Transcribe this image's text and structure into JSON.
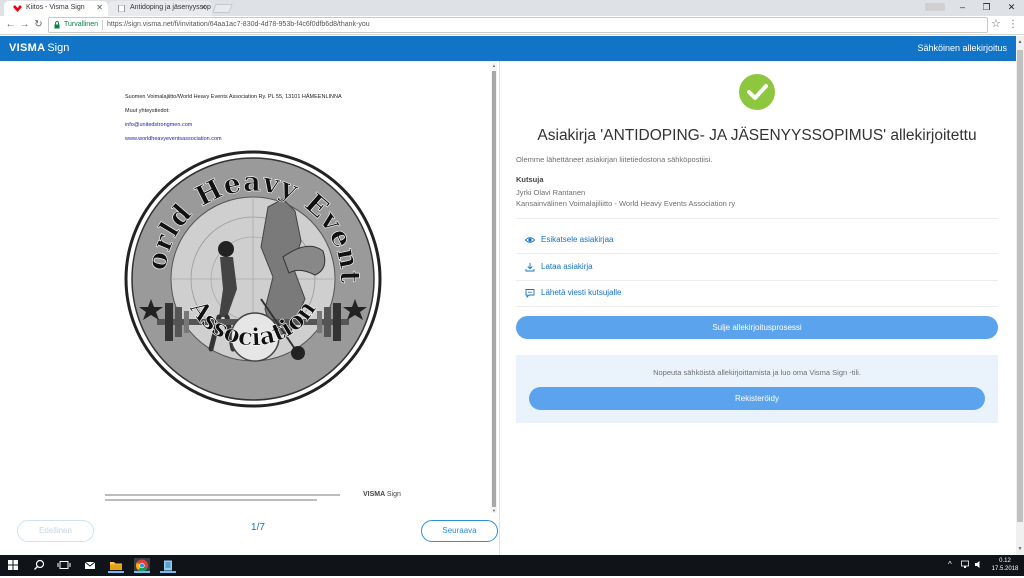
{
  "browser": {
    "tabs": [
      {
        "title": "Kiitos - Visma Sign",
        "active": true
      },
      {
        "title": "Antidoping ja jäsenyyssop",
        "active": false
      }
    ],
    "profile": "",
    "window_controls": {
      "minimize": "–",
      "maximize": "❐",
      "close": "✕"
    },
    "secure_label": "Turvallinen",
    "url": "https://sign.visma.net/fi/invitation/64aa1ac7-830d-4d78-953b-f4c6f0dfb6d8/thank-you"
  },
  "header": {
    "brand_bold": "VISMA",
    "brand_light": "Sign",
    "right_text": "Sähköinen allekirjoitus",
    "color": "#1174c7"
  },
  "document": {
    "address_line": "Suomen Voimalajiitto/World Heavy Events Association Ry. PL 55, 13101 HÄMEENLINNA",
    "contacts_label": "Muut yhteystiedot:",
    "email": "info@unitedstrongmen.com",
    "website": "www.worldheavyeventsassociation.com",
    "logo_text_top": "World Heavy Events",
    "logo_text_bottom": "Association",
    "footer_brand_bold": "VISMA",
    "footer_brand_light": "Sign",
    "page_counter": "1/7",
    "prev_label": "Edellinen",
    "next_label": "Seuraava"
  },
  "result": {
    "title": "Asiakirja 'ANTIDOPING- JA JÄSENYYSSOPIMUS' allekirjoitettu",
    "sent_text": "Olemme lähettäneet asiakirjan liitetiedostona sähköpostiisi.",
    "inviter_label": "Kutsuja",
    "inviter_name": "Jyrki Olavi Rantanen",
    "inviter_org": "Kansainvälinen Voimalajiliitto - World Heavy Events Association ry",
    "actions": [
      {
        "label": "Esikatsele asiakirjaa",
        "icon": "eye-icon"
      },
      {
        "label": "Lataa asiakirja",
        "icon": "download-icon"
      },
      {
        "label": "Lähetä viesti kutsujalle",
        "icon": "message-icon"
      }
    ],
    "close_button": "Sulje allekirjoitusprosessi",
    "register_text": "Nopeuta sähköistä allekirjoittamista ja luo oma Visma Sign -tili.",
    "register_button": "Rekisteröidy",
    "check_color": "#8dc63f",
    "button_color": "#5ba3ec"
  },
  "taskbar": {
    "time": "0.12",
    "date": "17.5.2018"
  }
}
